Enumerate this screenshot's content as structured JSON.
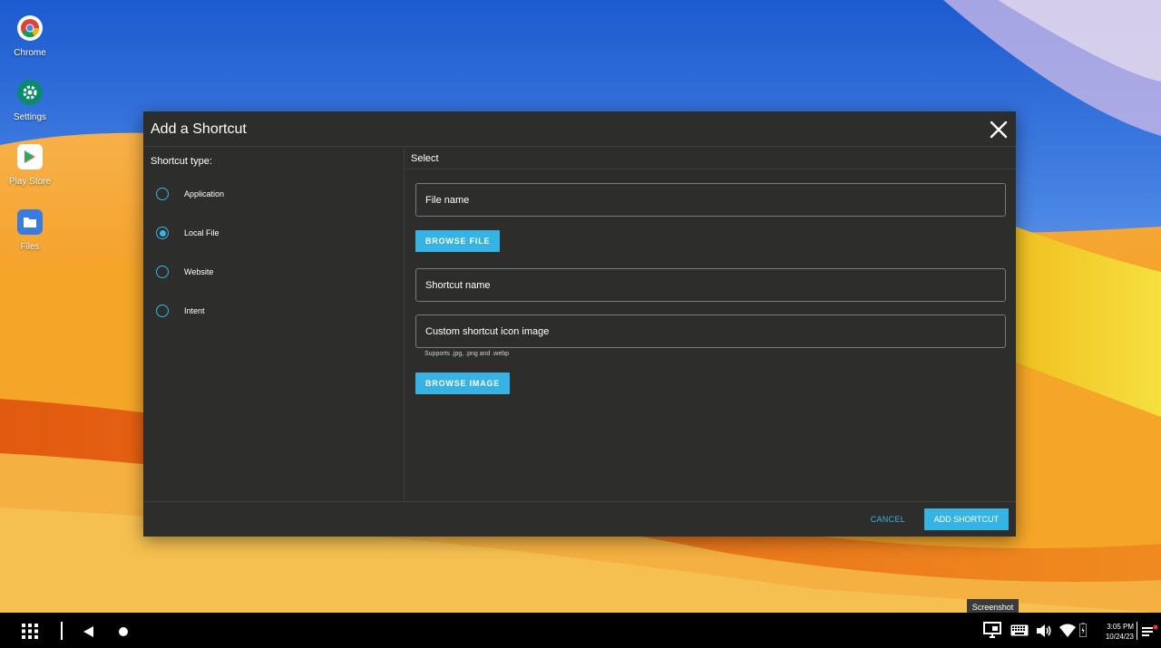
{
  "desktop": {
    "icons": [
      {
        "label": "Chrome"
      },
      {
        "label": "Settings"
      },
      {
        "label": "Play Store"
      },
      {
        "label": "Files"
      }
    ]
  },
  "dialog": {
    "title": "Add a Shortcut",
    "shortcut_type_label": "Shortcut type:",
    "types": [
      {
        "label": "Application",
        "selected": false
      },
      {
        "label": "Local File",
        "selected": true
      },
      {
        "label": "Website",
        "selected": false
      },
      {
        "label": "Intent",
        "selected": false
      }
    ],
    "select_header": "Select",
    "file_name_placeholder": "File name",
    "browse_file_label": "BROWSE FILE",
    "shortcut_name_placeholder": "Shortcut name",
    "custom_icon_placeholder": "Custom shortcut icon image",
    "custom_icon_hint": "Supports .jpg, .png and .webp",
    "browse_image_label": "BROWSE IMAGE",
    "cancel_label": "CANCEL",
    "add_label": "ADD SHORTCUT"
  },
  "tooltip": "Screenshot",
  "taskbar": {
    "time": "3:05 PM",
    "date": "10/24/23"
  },
  "colors": {
    "accent": "#36b3e2",
    "dialog_bg": "#2d2e2c",
    "taskbar_bg": "#000000"
  }
}
